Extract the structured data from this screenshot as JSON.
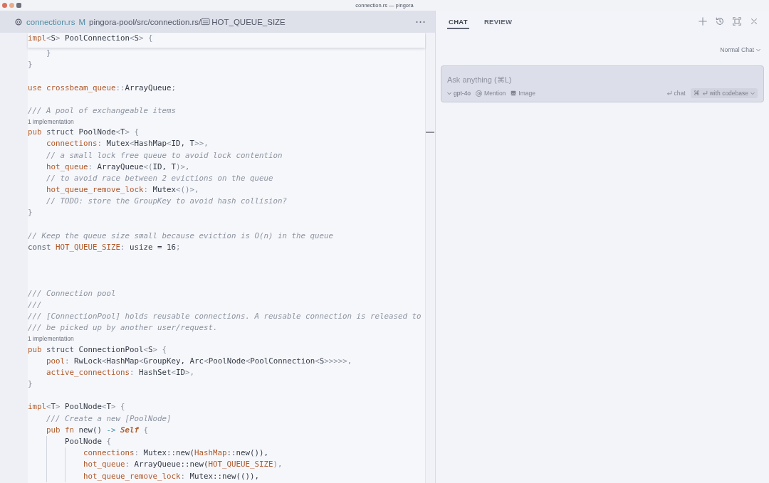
{
  "window": {
    "title": "connection.rs — pingora"
  },
  "editor": {
    "tab": {
      "file_name": "connection.rs",
      "status": "M",
      "path": "pingora-pool/src/connection.rs/",
      "symbol": "HOT_QUEUE_SIZE"
    },
    "sticky_line": {
      "tokens": [
        {
          "text": "impl",
          "kind": "keyword"
        },
        {
          "text": "<",
          "kind": "punct"
        },
        {
          "text": "S",
          "kind": "type"
        },
        {
          "text": "> ",
          "kind": "punct"
        },
        {
          "text": "PoolConnection",
          "kind": "type"
        },
        {
          "text": "<",
          "kind": "punct"
        },
        {
          "text": "S",
          "kind": "type"
        },
        {
          "text": "> {",
          "kind": "punct"
        }
      ]
    },
    "lines": [
      {
        "kind": "code",
        "tokens": [
          {
            "text": "    }",
            "kind": "punct"
          }
        ]
      },
      {
        "kind": "code",
        "tokens": [
          {
            "text": "}",
            "kind": "punct"
          }
        ]
      },
      {
        "kind": "blank"
      },
      {
        "kind": "code",
        "tokens": [
          {
            "text": "use",
            "kind": "keyword"
          },
          {
            "text": " crossbeam_queue",
            "kind": "field"
          },
          {
            "text": "::",
            "kind": "punct"
          },
          {
            "text": "ArrayQueue",
            "kind": "type"
          },
          {
            "text": ";",
            "kind": "punct"
          }
        ]
      },
      {
        "kind": "blank"
      },
      {
        "kind": "code",
        "tokens": [
          {
            "text": "/// A pool of exchangeable items",
            "kind": "comment"
          }
        ]
      },
      {
        "kind": "codelens",
        "text": "1 implementation"
      },
      {
        "kind": "code",
        "tokens": [
          {
            "text": "pub",
            "kind": "keyword"
          },
          {
            "text": " struct ",
            "kind": "declaration"
          },
          {
            "text": "PoolNode",
            "kind": "type"
          },
          {
            "text": "<",
            "kind": "punct"
          },
          {
            "text": "T",
            "kind": "type"
          },
          {
            "text": "> {",
            "kind": "punct"
          }
        ]
      },
      {
        "kind": "code",
        "tokens": [
          {
            "text": "    connections",
            "kind": "field"
          },
          {
            "text": ": ",
            "kind": "punct"
          },
          {
            "text": "Mutex",
            "kind": "type"
          },
          {
            "text": "<",
            "kind": "punct"
          },
          {
            "text": "HashMap",
            "kind": "type"
          },
          {
            "text": "<",
            "kind": "punct"
          },
          {
            "text": "ID, T",
            "kind": "type"
          },
          {
            "text": ">>,",
            "kind": "punct"
          }
        ]
      },
      {
        "kind": "code",
        "tokens": [
          {
            "text": "    // a small lock free queue to avoid lock contention",
            "kind": "comment"
          }
        ]
      },
      {
        "kind": "code",
        "tokens": [
          {
            "text": "    hot_queue",
            "kind": "field"
          },
          {
            "text": ": ",
            "kind": "punct"
          },
          {
            "text": "ArrayQueue",
            "kind": "type"
          },
          {
            "text": "<(",
            "kind": "punct"
          },
          {
            "text": "ID, T",
            "kind": "type"
          },
          {
            "text": ")>,",
            "kind": "punct"
          }
        ]
      },
      {
        "kind": "code",
        "tokens": [
          {
            "text": "    // to avoid race between 2 evictions on the queue",
            "kind": "comment"
          }
        ]
      },
      {
        "kind": "code",
        "tokens": [
          {
            "text": "    hot_queue_remove_lock",
            "kind": "field"
          },
          {
            "text": ": ",
            "kind": "punct"
          },
          {
            "text": "Mutex",
            "kind": "type"
          },
          {
            "text": "<()>,",
            "kind": "punct"
          }
        ]
      },
      {
        "kind": "code",
        "tokens": [
          {
            "text": "    // TODO: store the GroupKey to avoid hash collision?",
            "kind": "comment"
          }
        ]
      },
      {
        "kind": "code",
        "tokens": [
          {
            "text": "}",
            "kind": "punct"
          }
        ]
      },
      {
        "kind": "blank"
      },
      {
        "kind": "code",
        "tokens": [
          {
            "text": "// Keep the queue size small because eviction is O(n) in the queue",
            "kind": "comment"
          }
        ]
      },
      {
        "kind": "code",
        "tokens": [
          {
            "text": "const ",
            "kind": "declaration"
          },
          {
            "text": "HOT_QUEUE_SIZE",
            "kind": "field"
          },
          {
            "text": ": ",
            "kind": "punct"
          },
          {
            "text": "usize = 16",
            "kind": "type"
          },
          {
            "text": ";",
            "kind": "punct"
          }
        ]
      },
      {
        "kind": "blank"
      },
      {
        "kind": "blank"
      },
      {
        "kind": "blank"
      },
      {
        "kind": "code",
        "tokens": [
          {
            "text": "/// Connection pool",
            "kind": "comment"
          }
        ]
      },
      {
        "kind": "code",
        "tokens": [
          {
            "text": "///",
            "kind": "comment"
          }
        ]
      },
      {
        "kind": "code",
        "tokens": [
          {
            "text": "/// [ConnectionPool] holds reusable connections. A reusable connection is released to",
            "kind": "comment"
          }
        ]
      },
      {
        "kind": "code",
        "tokens": [
          {
            "text": "/// be picked up by another user/request.",
            "kind": "comment"
          }
        ]
      },
      {
        "kind": "codelens",
        "text": "1 implementation"
      },
      {
        "kind": "code",
        "tokens": [
          {
            "text": "pub",
            "kind": "keyword"
          },
          {
            "text": " struct ",
            "kind": "declaration"
          },
          {
            "text": "ConnectionPool",
            "kind": "type"
          },
          {
            "text": "<",
            "kind": "punct"
          },
          {
            "text": "S",
            "kind": "type"
          },
          {
            "text": "> {",
            "kind": "punct"
          }
        ]
      },
      {
        "kind": "code",
        "tokens": [
          {
            "text": "    pool",
            "kind": "field"
          },
          {
            "text": ": ",
            "kind": "punct"
          },
          {
            "text": "RwLock",
            "kind": "type"
          },
          {
            "text": "<",
            "kind": "punct"
          },
          {
            "text": "HashMap",
            "kind": "type"
          },
          {
            "text": "<",
            "kind": "punct"
          },
          {
            "text": "GroupKey, Arc",
            "kind": "type"
          },
          {
            "text": "<",
            "kind": "punct"
          },
          {
            "text": "PoolNode",
            "kind": "type"
          },
          {
            "text": "<",
            "kind": "punct"
          },
          {
            "text": "PoolConnection",
            "kind": "type"
          },
          {
            "text": "<",
            "kind": "punct"
          },
          {
            "text": "S",
            "kind": "type"
          },
          {
            "text": ">>>>>,",
            "kind": "punct"
          }
        ]
      },
      {
        "kind": "code",
        "tokens": [
          {
            "text": "    active_connections",
            "kind": "field"
          },
          {
            "text": ": ",
            "kind": "punct"
          },
          {
            "text": "HashSet",
            "kind": "type"
          },
          {
            "text": "<",
            "kind": "punct"
          },
          {
            "text": "ID",
            "kind": "type"
          },
          {
            "text": ">,",
            "kind": "punct"
          }
        ]
      },
      {
        "kind": "code",
        "tokens": [
          {
            "text": "}",
            "kind": "punct"
          }
        ]
      },
      {
        "kind": "blank"
      },
      {
        "kind": "code",
        "tokens": [
          {
            "text": "impl",
            "kind": "keyword"
          },
          {
            "text": "<",
            "kind": "punct"
          },
          {
            "text": "T",
            "kind": "type"
          },
          {
            "text": "> ",
            "kind": "punct"
          },
          {
            "text": "PoolNode",
            "kind": "type"
          },
          {
            "text": "<",
            "kind": "punct"
          },
          {
            "text": "T",
            "kind": "type"
          },
          {
            "text": "> {",
            "kind": "punct"
          }
        ]
      },
      {
        "kind": "code",
        "tokens": [
          {
            "text": "    /// Create a new [PoolNode]",
            "kind": "comment"
          }
        ]
      },
      {
        "kind": "code",
        "tokens": [
          {
            "text": "    pub fn",
            "kind": "keyword"
          },
          {
            "text": " new() ",
            "kind": "type"
          },
          {
            "text": "-> ",
            "kind": "operator"
          },
          {
            "text": "Self",
            "kind": "self"
          },
          {
            "text": " {",
            "kind": "punct"
          }
        ]
      },
      {
        "kind": "code",
        "tokens": [
          {
            "text": "        PoolNode",
            "kind": "type"
          },
          {
            "text": " {",
            "kind": "punct"
          }
        ]
      },
      {
        "kind": "code",
        "tokens": [
          {
            "text": "            connections",
            "kind": "field"
          },
          {
            "text": ": ",
            "kind": "punct"
          },
          {
            "text": "Mutex::new(",
            "kind": "type"
          },
          {
            "text": "HashMap",
            "kind": "field"
          },
          {
            "text": "::new()),",
            "kind": "type"
          }
        ]
      },
      {
        "kind": "code",
        "tokens": [
          {
            "text": "            hot_queue",
            "kind": "field"
          },
          {
            "text": ": ",
            "kind": "punct"
          },
          {
            "text": "ArrayQueue::new(",
            "kind": "type"
          },
          {
            "text": "HOT_QUEUE_SIZE",
            "kind": "field"
          },
          {
            "text": "),",
            "kind": "punct"
          }
        ]
      },
      {
        "kind": "code",
        "tokens": [
          {
            "text": "            hot_queue_remove_lock",
            "kind": "field"
          },
          {
            "text": ": ",
            "kind": "punct"
          },
          {
            "text": "Mutex::new(()),",
            "kind": "type"
          }
        ]
      }
    ]
  },
  "chat_panel": {
    "tabs": [
      {
        "label": "CHAT",
        "selected": true
      },
      {
        "label": "REVIEW",
        "selected": false
      }
    ],
    "mode": "Normal Chat",
    "composer": {
      "placeholder": "Ask anything (⌘L)",
      "model": "gpt-4o",
      "mention": "Mention",
      "image": "Image",
      "send": "chat",
      "codebase_shortcut": "⌘",
      "codebase": "with codebase"
    }
  }
}
